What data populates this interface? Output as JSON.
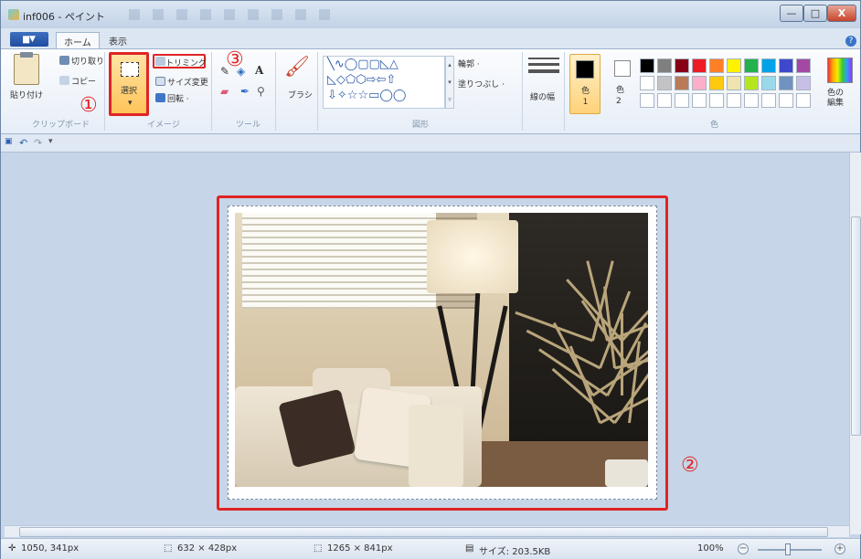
{
  "window": {
    "title": "inf006 - ペイント",
    "minimize": "—",
    "maximize": "□",
    "close": "X"
  },
  "menu": {
    "file_label": "▆▼",
    "tabs": [
      {
        "label": "ホーム"
      },
      {
        "label": "表示"
      }
    ],
    "help": "?"
  },
  "ribbon": {
    "clipboard": {
      "paste": "貼り付け",
      "cut": "切り取り",
      "copy": "コピー",
      "group": "クリップボード"
    },
    "image": {
      "select": "選択",
      "crop": "トリミング",
      "resize": "サイズ変更",
      "rotate": "回転 ·",
      "group": "イメージ"
    },
    "tools": {
      "group": "ツール"
    },
    "brush": {
      "label": "ブラシ"
    },
    "shapes": {
      "row1": "╲∿◯▢▢◺△",
      "row2": "◺◇⬠⬡⇨⇦⇧",
      "row3": "⇩✧☆☆▭◯◯",
      "outline": "輪郭 ·",
      "fill": "塗りつぶし ·",
      "group": "図形"
    },
    "size": {
      "label": "線の幅"
    },
    "colors": {
      "color1": "色\n1",
      "color2": "色\n2",
      "edit": "色の\n編集",
      "group": "色",
      "palette": [
        "#000000",
        "#7f7f7f",
        "#880015",
        "#ed1c24",
        "#ff7f27",
        "#fff200",
        "#22b14c",
        "#00a2e8",
        "#3f48cc",
        "#a349a4",
        "#ffffff",
        "#c3c3c3",
        "#b97a57",
        "#ffaec9",
        "#ffc90e",
        "#efe4b0",
        "#b5e61d",
        "#99d9ea",
        "#7092be",
        "#c8bfe7"
      ]
    }
  },
  "qat": {
    "save": "▣",
    "undo": "↶",
    "redo": "↷",
    "more": "▾"
  },
  "status": {
    "cursor": "1050, 341px",
    "selection": "632 × 428px",
    "image_size": "1265 × 841px",
    "file_size": "サイズ: 203.5KB",
    "zoom": "100%"
  },
  "markers": {
    "m1": "①",
    "m2": "②",
    "m3": "③"
  },
  "colors": {
    "highlight": "#e02424",
    "ribbon_bg": "#e7eef7"
  }
}
